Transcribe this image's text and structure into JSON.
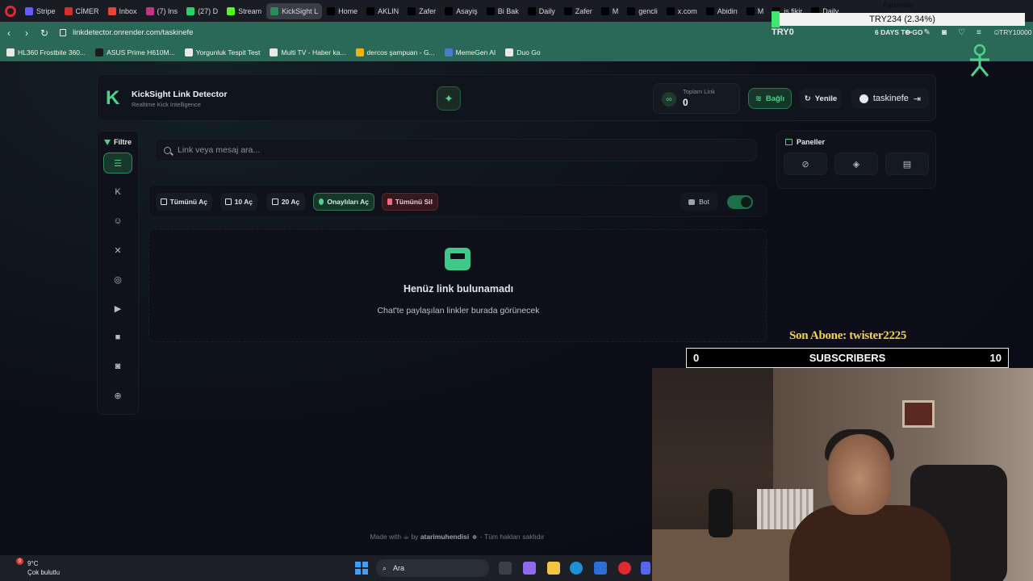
{
  "browser": {
    "tabs": [
      {
        "label": "Stripe",
        "icon": "stripe-icon",
        "color": "#635bff"
      },
      {
        "label": "CİMER",
        "icon": "cimer-icon",
        "color": "#d32f2f"
      },
      {
        "label": "Inbox",
        "icon": "gmail-icon",
        "color": "#ea4335"
      },
      {
        "label": "(7) Ins",
        "icon": "instagram-icon",
        "color": "#c13584"
      },
      {
        "label": "(27) D",
        "icon": "whatsapp-icon",
        "color": "#25d366"
      },
      {
        "label": "Stream",
        "icon": "kick-icon",
        "color": "#53fc18"
      },
      {
        "label": "KickSight L",
        "icon": "kicksight-icon",
        "color": "#2a8a5a",
        "active": true
      },
      {
        "label": "Home",
        "icon": "x-icon",
        "color": "#000000"
      },
      {
        "label": "AKLIN",
        "icon": "x-icon",
        "color": "#000000"
      },
      {
        "label": "Zafer",
        "icon": "x-icon",
        "color": "#000000"
      },
      {
        "label": "Asayiş",
        "icon": "x-icon",
        "color": "#000000"
      },
      {
        "label": "Bi Bak",
        "icon": "x-icon",
        "color": "#000000"
      },
      {
        "label": "Daily",
        "icon": "x-icon",
        "color": "#000000"
      },
      {
        "label": "Zafer",
        "icon": "x-icon",
        "color": "#000000"
      },
      {
        "label": "M",
        "icon": "x-icon",
        "color": "#000000"
      },
      {
        "label": "gencli",
        "icon": "x-icon",
        "color": "#000000"
      },
      {
        "label": "x.com",
        "icon": "x-icon",
        "color": "#000000"
      },
      {
        "label": "Abidin",
        "icon": "x-icon",
        "color": "#000000"
      },
      {
        "label": "M",
        "icon": "x-icon",
        "color": "#000000"
      },
      {
        "label": "iş fikir",
        "icon": "x-icon",
        "color": "#000000"
      },
      {
        "label": "Daily",
        "icon": "x-icon",
        "color": "#000000"
      }
    ],
    "url": "linkdetector.onrender.com/taskinefe",
    "bookmarks": [
      {
        "label": "HL360 Frostbite 360...",
        "color": "#e8e8e8"
      },
      {
        "label": "ASUS Prime H610M...",
        "color": "#1b1b1b"
      },
      {
        "label": "Yorgunluk Tespit Test",
        "color": "#e8e8e8"
      },
      {
        "label": "Multi TV - Haber ka...",
        "color": "#e8e8e8"
      },
      {
        "label": "dercos şampuan - G...",
        "color": "#f4b400"
      },
      {
        "label": "MemeGen AI",
        "color": "#4a7bd0"
      },
      {
        "label": "Duo Go",
        "color": "#e8e8e8"
      }
    ]
  },
  "app": {
    "brand_name": "KickSight Link Detector",
    "brand_sub": "Realtime Kick Intelligence",
    "stat_label": "Toplam Link",
    "stat_value": "0",
    "connected_label": "Bağlı",
    "refresh_label": "Yenile",
    "username": "taskinefe",
    "filter_label": "Filtre",
    "sidebar_icons": [
      "list-icon",
      "kick-icon",
      "user-icon",
      "x-icon",
      "instagram-icon",
      "youtube-icon",
      "video-icon",
      "camera-icon",
      "globe-icon"
    ],
    "search_placeholder": "Link veya mesaj ara...",
    "actions": {
      "open_all": "Tümünü Aç",
      "open_10": "10 Aç",
      "open_20": "20 Aç",
      "open_approved": "Onaylıları Aç",
      "delete_all": "Tümünü Sil",
      "bot": "Bot"
    },
    "bot_enabled": true,
    "empty_title": "Henüz link bulunamadı",
    "empty_sub": "Chat'te paylaşılan linkler burada görünecek",
    "panels_title": "Paneller",
    "footer": {
      "made_with": "Made with",
      "by": "by",
      "author": "atarimuhendisi",
      "rights": "- Tüm hakları saklıdır"
    },
    "accent": "#4fd18b"
  },
  "overlay": {
    "fatura": "Faturalar",
    "goal_text": "TRY234 (2.34%)",
    "goal_start": "TRY0",
    "goal_days": "6 DAYS TO GO",
    "goal_end": "TRY10000",
    "sub_label": "Son Abone: twister2225",
    "sub_count_left": "0",
    "sub_title": "SUBSCRIBERS",
    "sub_count_right": "10"
  },
  "taskbar": {
    "temperature": "9°C",
    "weather": "Çok bulutlu",
    "badge": "9",
    "search": "Ara"
  }
}
